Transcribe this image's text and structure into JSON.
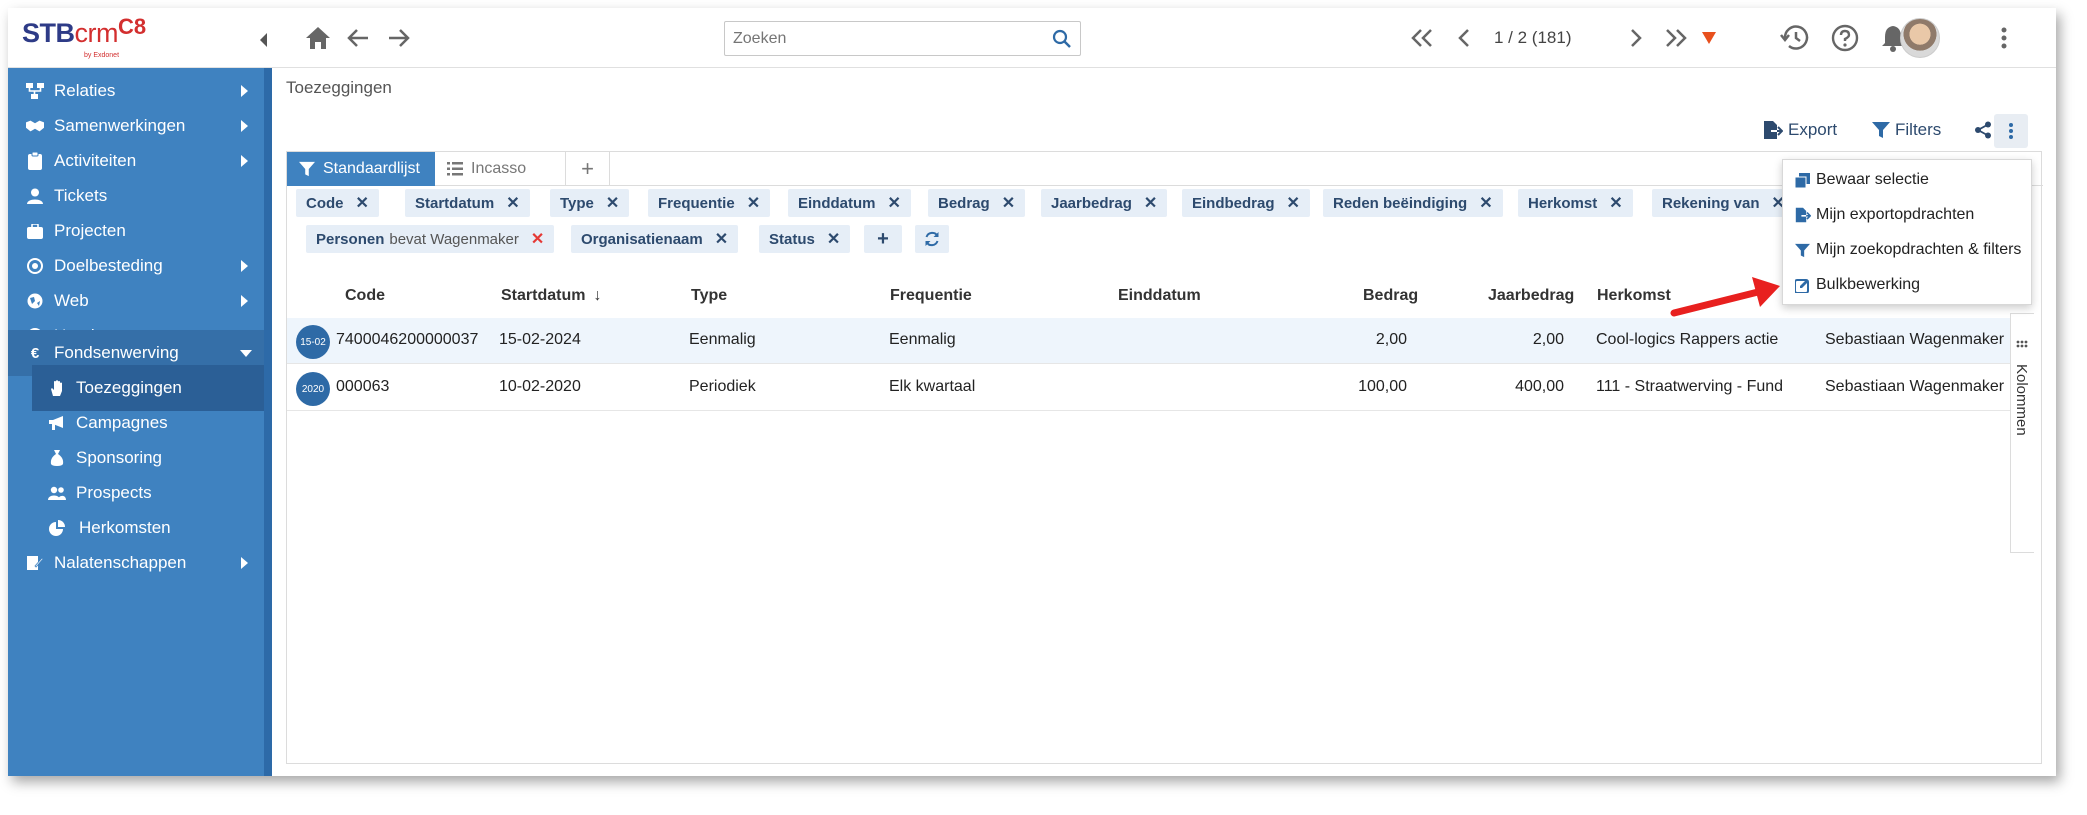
{
  "app": {
    "logo_text": "STB",
    "logo_crm": "crm",
    "logo_sub": "by Exdonet",
    "logo_mark": "C8"
  },
  "sidebar": {
    "items": [
      {
        "label": "Relaties",
        "icon": "sitemap-icon",
        "has_caret": true
      },
      {
        "label": "Samenwerkingen",
        "icon": "handshake-icon",
        "has_caret": true
      },
      {
        "label": "Activiteiten",
        "icon": "clipboard-icon",
        "has_caret": true
      },
      {
        "label": "Tickets",
        "icon": "user-icon",
        "has_caret": false
      },
      {
        "label": "Projecten",
        "icon": "briefcase-icon",
        "has_caret": false
      },
      {
        "label": "Doelbesteding",
        "icon": "target-icon",
        "has_caret": true
      },
      {
        "label": "Web",
        "icon": "globe-icon",
        "has_caret": true
      },
      {
        "label": "Urenkaarten",
        "icon": "clock-icon",
        "has_caret": true
      },
      {
        "label": "Fondsenwerving",
        "icon": "euro-icon",
        "has_caret": true,
        "expanded": true
      }
    ],
    "sub_items": [
      {
        "label": "Toezeggingen",
        "icon": "hand-icon",
        "active": true
      },
      {
        "label": "Campagnes",
        "icon": "megaphone-icon"
      },
      {
        "label": "Sponsoring",
        "icon": "money-bag-icon"
      },
      {
        "label": "Prospects",
        "icon": "users-icon"
      },
      {
        "label": "Herkomsten",
        "icon": "pie-chart-icon"
      }
    ],
    "last_item": {
      "label": "Nalatenschappen",
      "icon": "signature-icon",
      "has_caret": true
    }
  },
  "topbar": {
    "search_placeholder": "Zoeken",
    "pager": "1 / 2 (181)"
  },
  "page": {
    "breadcrumb": "Toezeggingen",
    "export_label": "Export",
    "filters_label": "Filters"
  },
  "tabs": [
    {
      "label": "Standaardlijst",
      "active": true
    },
    {
      "label": "Incasso",
      "active": false
    }
  ],
  "filter_chips": [
    {
      "label": "Code"
    },
    {
      "label": "Startdatum"
    },
    {
      "label": "Type"
    },
    {
      "label": "Frequentie"
    },
    {
      "label": "Einddatum"
    },
    {
      "label": "Bedrag"
    },
    {
      "label": "Jaarbedrag"
    },
    {
      "label": "Eindbedrag"
    },
    {
      "label": "Reden beëindiging"
    },
    {
      "label": "Herkomst"
    },
    {
      "label": "Rekening van"
    },
    {
      "label": "Personen",
      "extra": "bevat Wagenmaker"
    },
    {
      "label": "Organisatienaam"
    },
    {
      "label": "Status"
    }
  ],
  "table": {
    "headers": [
      "Code",
      "Startdatum",
      "Type",
      "Frequentie",
      "Einddatum",
      "Bedrag",
      "Jaarbedrag",
      "Herkomst"
    ],
    "rows": [
      {
        "badge": "15-02",
        "code": "7400046200000037",
        "startdatum": "15-02-2024",
        "type": "Eenmalig",
        "frequentie": "Eenmalig",
        "einddatum": "",
        "bedrag": "2,00",
        "jaarbedrag": "2,00",
        "herkomst": "Cool-logics Rappers actie",
        "persoon": "Sebastiaan Wagenmaker"
      },
      {
        "badge": "2020",
        "code": "000063",
        "startdatum": "10-02-2020",
        "type": "Periodiek",
        "frequentie": "Elk kwartaal",
        "einddatum": "",
        "bedrag": "100,00",
        "jaarbedrag": "400,00",
        "herkomst": "111 - Straatwerving - Fund",
        "persoon": "Sebastiaan Wagenmaker"
      }
    ]
  },
  "columns_panel_label": "Kolommen",
  "menu": [
    {
      "label": "Bewaar selectie",
      "icon": "copy-icon"
    },
    {
      "label": "Mijn exportopdrachten",
      "icon": "file-export-icon"
    },
    {
      "label": "Mijn zoekopdrachten & filters",
      "icon": "filter-icon"
    },
    {
      "label": "Bulkbewerking",
      "icon": "edit-icon"
    }
  ],
  "colors": {
    "sidebar": "#3f82c0",
    "accent": "#3f82c0",
    "chip_bg": "#e6eef7",
    "arrow": "#e8201f"
  }
}
